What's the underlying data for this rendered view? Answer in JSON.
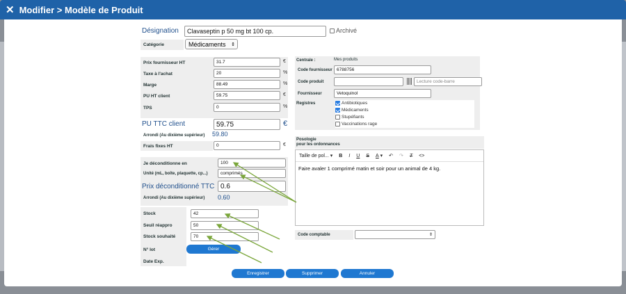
{
  "window": {
    "close_icon": "close-icon",
    "title": "Modifier > Modèle de Produit"
  },
  "designation": {
    "label": "Désignation",
    "value": "Clavaseptin p  50 mg          bt 100 cp.",
    "archive_label": "Archivé"
  },
  "categorie": {
    "label": "Catégorie",
    "value": "Médicaments"
  },
  "prix": {
    "fournisseur_label": "Prix fournisseur HT",
    "fournisseur_value": "31.7",
    "fournisseur_unit": "€",
    "taxe_label": "Taxe à l'achat",
    "taxe_value": "20",
    "taxe_unit": "%",
    "marge_label": "Marge",
    "marge_value": "88.49",
    "marge_unit": "%",
    "pu_ht_label": "PU HT client",
    "pu_ht_value": "59.75",
    "pu_ht_unit": "€",
    "tps_label": "TPS",
    "tps_value": "0",
    "tps_unit": "%",
    "pu_ttc_label": "PU TTC client",
    "pu_ttc_value": "59.75",
    "pu_ttc_unit": "€",
    "arrondi_label": "Arrondi (Au dixième supérieur)",
    "arrondi_value": "59.80",
    "frais_label": "Frais fixes HT",
    "frais_value": "0",
    "frais_unit": "€"
  },
  "deconditionnement": {
    "en_label": "Je déconditionne en",
    "en_value": "100",
    "unite_label": "Unité (mL, boîte, plaquette, cp...)",
    "unite_value": "comprimés",
    "prix_label": "Prix déconditionné TTC",
    "prix_value": "0.6",
    "arrondi_label": "Arrondi (Au dixième supérieur)",
    "arrondi_value": "0.60"
  },
  "stock": {
    "stock_label": "Stock",
    "stock_value": "42",
    "seuil_label": "Seuil réappro",
    "seuil_value": "50",
    "souhaite_label": "Stock souhaité",
    "souhaite_value": "70",
    "lot_label": "N° lot",
    "gerer_label": "Gérer",
    "date_label": "Date Exp."
  },
  "right": {
    "centrale_label": "Centrale :",
    "centrale_value": "Mes produits",
    "code_fournisseur_label": "Code fournisseur",
    "code_fournisseur_value": "6788756",
    "code_produit_label": "Code produit",
    "code_produit_value": "",
    "barcode_placeholder": "Lecture code-barre",
    "fournisseur_label": "Fournisseur",
    "fournisseur_value": "Vetoquinol",
    "registres_label": "Registres",
    "registres": [
      {
        "label": "Antibiotiques",
        "checked": true
      },
      {
        "label": "Médicaments",
        "checked": true
      },
      {
        "label": "Stupéfiants",
        "checked": false
      },
      {
        "label": "Vaccinations rage",
        "checked": false
      }
    ]
  },
  "posologie": {
    "label_line1": "Posologie",
    "label_line2": "pour les ordonnances",
    "font_size_select": "Taille de pol...",
    "toolbar": {
      "bold": "B",
      "italic": "I",
      "underline": "U",
      "strike": "S",
      "color": "A",
      "clear": "T",
      "code": "<>"
    },
    "text": "Faire avaler 1 comprimé matin et soir pour un animal de 4 kg."
  },
  "code_comptable": {
    "label": "Code comptable",
    "value": ""
  },
  "buttons": {
    "save": "Enregistrer",
    "delete": "Supprimer",
    "cancel": "Annuler"
  },
  "colors": {
    "titlebar": "#1f62a8",
    "button": "#1f78d1",
    "arrow": "#7aa63a",
    "value_blue": "#1f4f8c"
  }
}
